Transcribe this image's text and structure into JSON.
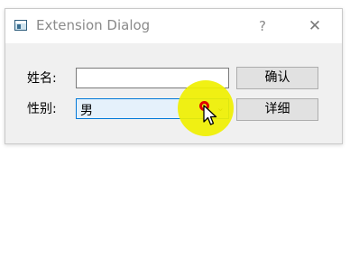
{
  "window": {
    "title": "Extension Dialog",
    "help_label": "?",
    "close_label": "✕"
  },
  "form": {
    "name_label": "姓名:",
    "name_value": "",
    "gender_label": "性别:",
    "gender_value": "男",
    "dropdown_arrow": "⌄"
  },
  "buttons": {
    "confirm_label": "确认",
    "detail_label": "详细"
  },
  "colors": {
    "combo_focus_border": "#0078d7",
    "combo_background": "#e5f1fb",
    "cursor_highlight": "#f0f000",
    "click_ring": "#e00000"
  }
}
